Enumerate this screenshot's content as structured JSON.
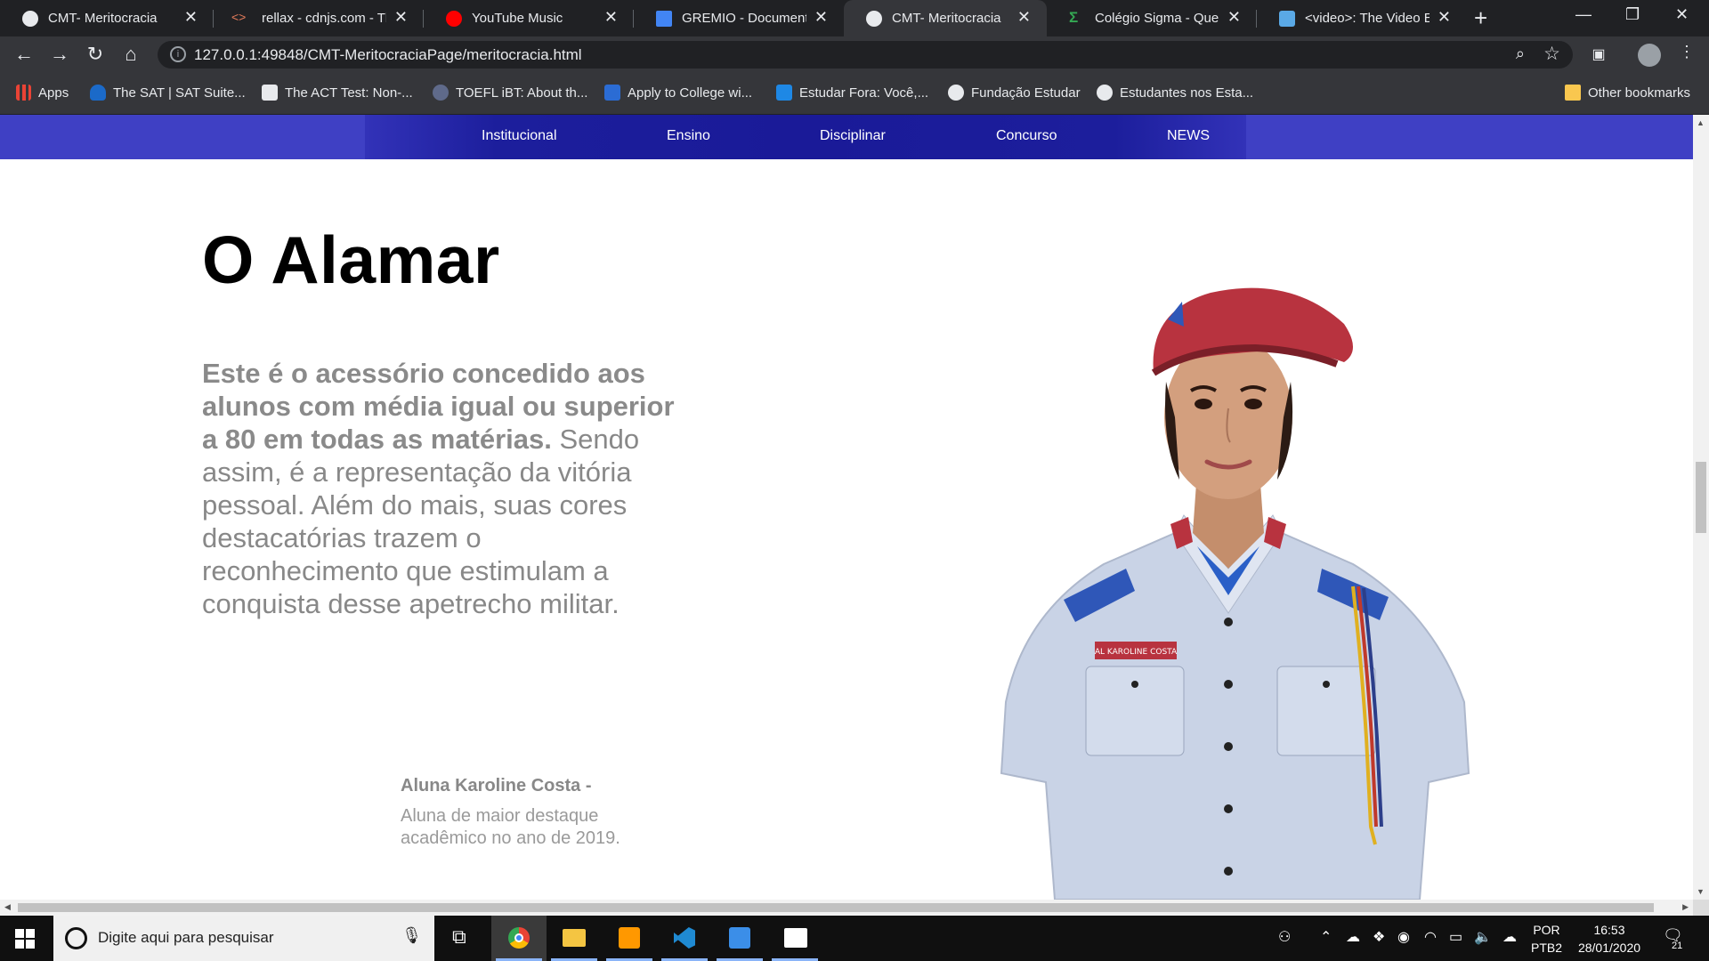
{
  "browser": {
    "tabs": [
      {
        "title": "CMT- Meritocracia",
        "active": false
      },
      {
        "title": "rellax - cdnjs.com - The",
        "active": false
      },
      {
        "title": "YouTube Music",
        "active": false
      },
      {
        "title": "GREMIO - Documentos",
        "active": false
      },
      {
        "title": "CMT- Meritocracia",
        "active": true
      },
      {
        "title": "Colégio Sigma - Quem",
        "active": false
      },
      {
        "title": "<video>: The Video Em",
        "active": false
      }
    ],
    "url": "127.0.0.1:49848/CMT-MeritocraciaPage/meritocracia.html",
    "bookmarks": [
      "Apps",
      "The SAT | SAT Suite...",
      "The ACT Test: Non-...",
      "TOEFL iBT: About th...",
      "Apply to College wi...",
      "Estudar Fora: Você,...",
      "Fundação Estudar",
      "Estudantes nos Esta...",
      "Other bookmarks"
    ]
  },
  "site": {
    "nav": [
      "Institucional",
      "Ensino",
      "Disciplinar",
      "Concurso",
      "NEWS"
    ],
    "heading": "O Alamar",
    "desc_bold": "Este é o acessório concedido aos alunos com média igual ou superior a 80 em todas as matérias.",
    "desc_rest": " Sendo assim, é a representação da vitória pessoal. Além do mais, suas cores destacatórias trazem o reconhecimento que estimulam a conquista desse apetrecho militar.",
    "caption_name": "Aluna Karoline Costa -",
    "caption_text": "Aluna de maior destaque acadêmico no ano de 2019.",
    "nametag": "AL KAROLINE COSTA"
  },
  "taskbar": {
    "search_placeholder": "Digite aqui para pesquisar",
    "lang_line1": "POR",
    "lang_line2": "PTB2",
    "time": "16:53",
    "date": "28/01/2020",
    "notifications": "21"
  },
  "colors": {
    "nav_bar": "#3f40c4",
    "nav_glow": "#1a1a98",
    "text_gray": "#888888",
    "beret": "#b8333f"
  }
}
